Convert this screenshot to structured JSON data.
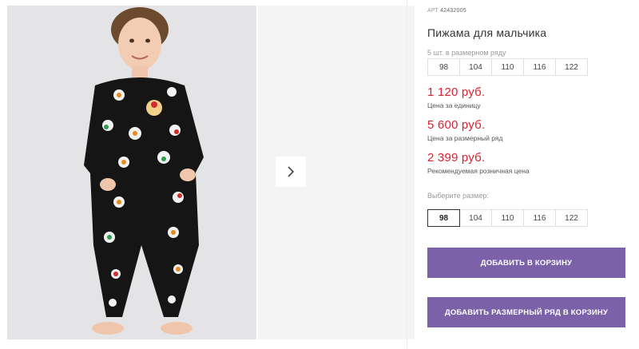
{
  "gallery": {
    "next_icon": "chevron-right-icon"
  },
  "product": {
    "art_label": "АРТ",
    "art_number": "42432005",
    "title": "Пижама для мальчика",
    "row_label": "5 шт. в размерном ряду",
    "row_sizes": [
      "98",
      "104",
      "110",
      "116",
      "122"
    ],
    "prices": [
      {
        "value": "1 120 руб.",
        "note": "Цена за единицу"
      },
      {
        "value": "5 600 руб.",
        "note": "Цена за размерный ряд"
      },
      {
        "value": "2 399 руб.",
        "note": "Рекомендуемая розничная цена"
      }
    ],
    "choose_label": "Выберите размер:",
    "choose_sizes": [
      "98",
      "104",
      "110",
      "116",
      "122"
    ],
    "selected_size": "98",
    "add_to_cart": "ДОБАВИТЬ В КОРЗИНУ",
    "add_row_to_cart": "ДОБАВИТЬ РАЗМЕРНЫЙ РЯД В КОРЗИНУ"
  },
  "colors": {
    "price": "#e0202f",
    "button": "#7b62a8"
  }
}
